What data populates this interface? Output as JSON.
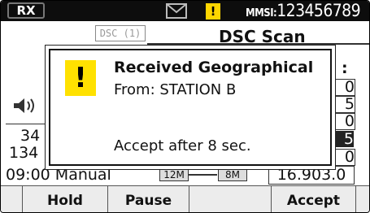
{
  "status_bar": {
    "rx_label": "RX",
    "mmsi_prefix": "MMSI:",
    "mmsi_number": "123456789",
    "icons": {
      "envelope": "envelope-icon",
      "warning": "warning-icon"
    }
  },
  "background": {
    "dsc_tab": "DSC (1)",
    "screen_title": "DSC Scan",
    "colon": ":",
    "right_column": [
      "0",
      "5",
      "0",
      "5",
      "0"
    ],
    "left_partial_1": "34",
    "left_partial_2": "134",
    "time_mode": "09:00 Manual",
    "scale_left": "12M",
    "scale_right": "8M",
    "position_value": "16.903.0",
    "speaker_icon": "speaker-icon"
  },
  "dialog": {
    "title": "Received Geographical",
    "from": "From: STATION B",
    "countdown": "Accept after 8 sec."
  },
  "softkeys": [
    {
      "label": "Hold"
    },
    {
      "label": "Pause"
    },
    {
      "label": ""
    },
    {
      "label": "Accept"
    }
  ],
  "colors": {
    "warning_yellow": "#ffe100",
    "status_bar": "#0d0d0d"
  }
}
